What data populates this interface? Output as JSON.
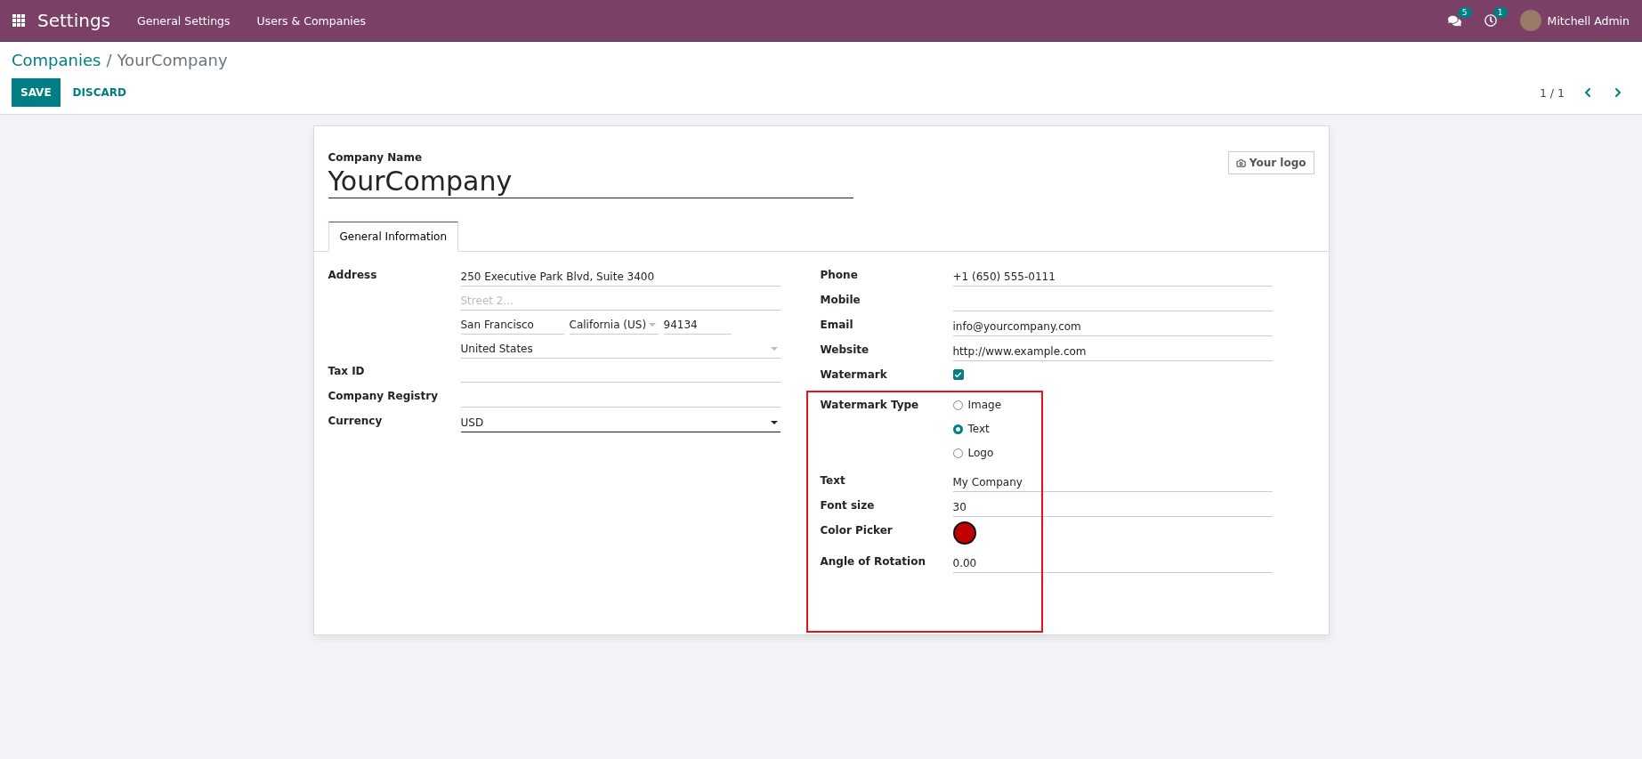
{
  "navbar": {
    "app_title": "Settings",
    "menu": [
      "General Settings",
      "Users & Companies"
    ],
    "messages_count": "5",
    "activities_count": "1",
    "user": "Mitchell Admin"
  },
  "breadcrumb": {
    "parent": "Companies",
    "separator": "/",
    "current": "YourCompany"
  },
  "buttons": [
    {
      "label": "SAVE",
      "kind": "primary"
    },
    {
      "label": "DISCARD",
      "kind": "link"
    }
  ],
  "pager": {
    "text": "1 / 1"
  },
  "form": {
    "name_label": "Company Name",
    "name": "YourCompany",
    "logo_button": "Your logo",
    "tabs": [
      {
        "label": "General Information",
        "selected": true
      }
    ],
    "left": [
      {
        "kind": "address",
        "label": "Address",
        "street": "250 Executive Park Blvd, Suite 3400",
        "street2_placeholder": "Street 2...",
        "city": "San Francisco",
        "state": "California (US)",
        "zip": "94134",
        "country": "United States"
      },
      {
        "kind": "text",
        "label": "Tax ID"
      },
      {
        "kind": "text",
        "label": "Company Registry"
      },
      {
        "kind": "select",
        "label": "Currency",
        "value": "USD"
      }
    ],
    "right": [
      {
        "kind": "text",
        "label": "Phone",
        "value": "+1 (650) 555-0111"
      },
      {
        "kind": "text",
        "label": "Mobile"
      },
      {
        "kind": "text",
        "label": "Email",
        "value": "info@yourcompany.com"
      },
      {
        "kind": "text",
        "label": "Website",
        "value": "http://www.example.com"
      },
      {
        "kind": "checkbox",
        "label": "Watermark",
        "checked": true
      }
    ],
    "watermark_section": {
      "highlighted": true,
      "rows": [
        {
          "kind": "radio",
          "label": "Watermark Type",
          "options": [
            {
              "label": "Image",
              "selected": false
            },
            {
              "label": "Text",
              "selected": true
            },
            {
              "label": "Logo",
              "selected": false
            }
          ]
        },
        {
          "kind": "text",
          "label": "Text",
          "value": "My Company"
        },
        {
          "kind": "text",
          "label": "Font size",
          "value": "30"
        },
        {
          "kind": "color",
          "label": "Color Picker",
          "color": "#c00000"
        },
        {
          "kind": "text",
          "label": "Angle of Rotation",
          "value": "0.00"
        }
      ]
    }
  }
}
